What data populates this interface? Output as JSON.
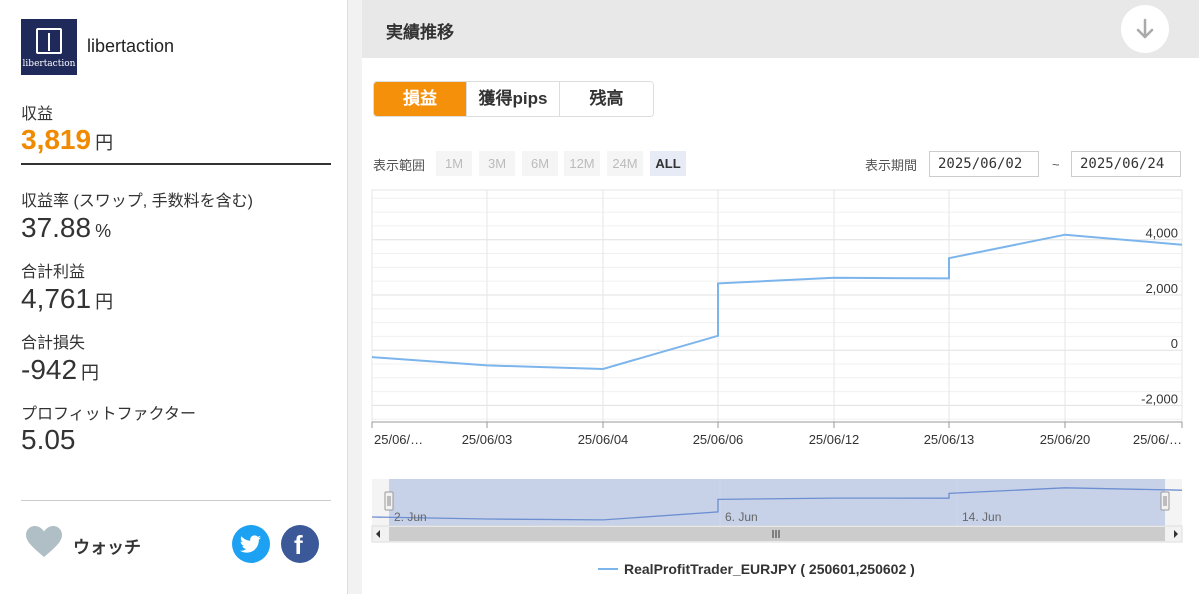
{
  "account": {
    "logo_text": "libertaction",
    "name": "libertaction"
  },
  "stats": {
    "profit_label": "収益",
    "profit_value": "3,819",
    "profit_unit": "円",
    "return_rate_label": "収益率 (スワップ, 手数料を含む)",
    "return_rate_value": "37.88",
    "return_rate_unit": "%",
    "total_profit_label": "合計利益",
    "total_profit_value": "4,761",
    "total_profit_unit": "円",
    "total_loss_label": "合計損失",
    "total_loss_value": "-942",
    "total_loss_unit": "円",
    "profit_factor_label": "プロフィットファクター",
    "profit_factor_value": "5.05"
  },
  "watch": {
    "label": "ウォッチ",
    "icon": "heart-icon"
  },
  "social": {
    "twitter_icon": "twitter-icon",
    "facebook_icon": "facebook-icon",
    "facebook_glyph": "f"
  },
  "section": {
    "title": "実績推移",
    "collapse_icon": "arrow-down-icon"
  },
  "tabs": [
    {
      "label": "損益",
      "active": true
    },
    {
      "label": "獲得pips",
      "active": false
    },
    {
      "label": "残高",
      "active": false
    }
  ],
  "range": {
    "label": "表示範囲",
    "buttons": [
      "1M",
      "3M",
      "6M",
      "12M",
      "24M",
      "ALL"
    ],
    "active": "ALL"
  },
  "period": {
    "label": "表示期間",
    "from": "2025/06/02",
    "separator": "~",
    "to": "2025/06/24"
  },
  "colors": {
    "accent": "#f5900a",
    "line": "#7cb5ec",
    "navigator_fill": "#b8c7e6"
  },
  "chart_data": {
    "type": "line",
    "x_tick_labels": [
      "25/06/…",
      "25/06/03",
      "25/06/04",
      "25/06/06",
      "25/06/12",
      "25/06/13",
      "25/06/20",
      "25/06/…"
    ],
    "y_ticks": [
      4000,
      2000,
      0,
      -2000
    ],
    "y_tick_labels": [
      "4,000",
      "2,000",
      "0",
      "-2,000"
    ],
    "ylim": [
      -2600,
      5800
    ],
    "series": [
      {
        "name": "RealProfitTrader_EURJPY ( 250601,250602 )",
        "points": [
          {
            "x": 0,
            "y": -250
          },
          {
            "x": 1,
            "y": -550
          },
          {
            "x": 2,
            "y": -680
          },
          {
            "x": 3,
            "y": 520
          },
          {
            "x": 3,
            "y": 2420
          },
          {
            "x": 4,
            "y": 2620
          },
          {
            "x": 5,
            "y": 2600
          },
          {
            "x": 5,
            "y": 3330
          },
          {
            "x": 6,
            "y": 4180
          },
          {
            "x": 7,
            "y": 3820
          }
        ]
      }
    ],
    "navigator_labels": [
      "2. Jun",
      "6. Jun",
      "14. Jun"
    ],
    "grid": true
  }
}
